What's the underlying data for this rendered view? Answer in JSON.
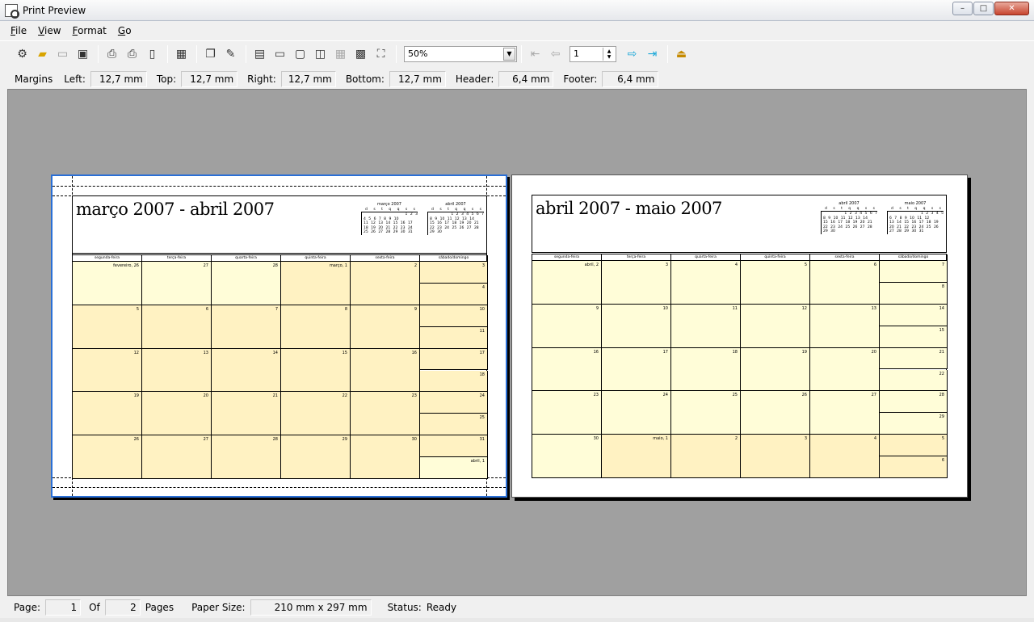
{
  "window": {
    "title": "Print Preview",
    "minimize": "–",
    "maximize": "□",
    "close": "✕"
  },
  "menu": [
    {
      "pre": "",
      "u": "F",
      "post": "ile"
    },
    {
      "pre": "",
      "u": "V",
      "post": "iew"
    },
    {
      "pre": "",
      "u": "F",
      "post": "ormat"
    },
    {
      "pre": "",
      "u": "G",
      "post": "o"
    }
  ],
  "toolbar": {
    "zoom_value": "50%",
    "page_value": "1"
  },
  "margins": {
    "label": "Margins",
    "left_label": "Left:",
    "left": "12,7 mm",
    "top_label": "Top:",
    "top": "12,7 mm",
    "right_label": "Right:",
    "right": "12,7 mm",
    "bottom_label": "Bottom:",
    "bottom": "12,7 mm",
    "header_label": "Header:",
    "header": "6,4 mm",
    "footer_label": "Footer:",
    "footer": "6,4 mm"
  },
  "pages": [
    {
      "title": "março 2007 - abril 2007",
      "mini1": {
        "title": "março 2007",
        "days": "d s t q q s s",
        "rows": [
          "1 2 3",
          "4 5 6 7 8 9 10",
          "11 12 13 14 15 16 17",
          "18 19 20 21 22 23 24",
          "25 26 27 28 29 30 31"
        ]
      },
      "mini2": {
        "title": "abril 2007",
        "days": "d s t q q s s",
        "rows": [
          "1 2 3 4 5 6 7",
          "8 9 10 11 12 13 14",
          "15 16 17 18 19 20 21",
          "22 23 24 25 26 27 28",
          "29 30"
        ]
      },
      "columns": [
        "segunda-feira",
        "terça-feira",
        "quarta-feira",
        "quinta-feira",
        "sexta-feira",
        "sábado/domingo"
      ],
      "weeks": [
        [
          "fevereiro, 26",
          "27",
          "28",
          "março, 1",
          "2",
          "3",
          "4"
        ],
        [
          "5",
          "6",
          "7",
          "8",
          "9",
          "10",
          "11"
        ],
        [
          "12",
          "13",
          "14",
          "15",
          "16",
          "17",
          "18"
        ],
        [
          "19",
          "20",
          "21",
          "22",
          "23",
          "24",
          "25"
        ],
        [
          "26",
          "27",
          "28",
          "29",
          "30",
          "31",
          "abril, 1"
        ]
      ]
    },
    {
      "title": "abril 2007 - maio 2007",
      "mini1": {
        "title": "abril 2007",
        "days": "d s t q q s s",
        "rows": [
          "1 2 3 4 5 6 7",
          "8 9 10 11 12 13 14",
          "15 16 17 18 19 20 21",
          "22 23 24 25 26 27 28",
          "29 30"
        ]
      },
      "mini2": {
        "title": "maio 2007",
        "days": "d s t q q s s",
        "rows": [
          "1 2 3 4 5",
          "6 7 8 9 10 11 12",
          "13 14 15 16 17 18 19",
          "20 21 22 23 24 25 26",
          "27 28 29 30 31"
        ]
      },
      "columns": [
        "segunda-feira",
        "terça-feira",
        "quarta-feira",
        "quinta-feira",
        "sexta-feira",
        "sábado/domingo"
      ],
      "weeks": [
        [
          "abril, 2",
          "3",
          "4",
          "5",
          "6",
          "7",
          "8"
        ],
        [
          "9",
          "10",
          "11",
          "12",
          "13",
          "14",
          "15"
        ],
        [
          "16",
          "17",
          "18",
          "19",
          "20",
          "21",
          "22"
        ],
        [
          "23",
          "24",
          "25",
          "26",
          "27",
          "28",
          "29"
        ],
        [
          "30",
          "maio, 1",
          "2",
          "3",
          "4",
          "5",
          "6"
        ]
      ]
    }
  ],
  "status": {
    "page_label": "Page:",
    "page": "1",
    "of_label": "Of",
    "of": "2",
    "pages_label": "Pages",
    "paper_label": "Paper Size:",
    "paper": "210 mm x 297 mm",
    "status_label": "Status:",
    "status": "Ready"
  },
  "colors": {
    "cell_light": "#fffdd8",
    "cell_dark": "#fff2c2",
    "workspace": "#a0a0a0"
  }
}
